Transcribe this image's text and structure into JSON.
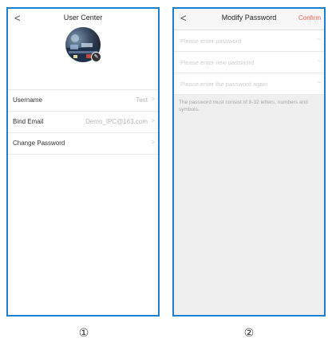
{
  "screen1": {
    "back_icon": "chevron-left-icon",
    "title": "User Center",
    "rows": [
      {
        "label": "Username",
        "value": "Test",
        "chevron": ">"
      },
      {
        "label": "Bind Email",
        "value": "Demo_IPC@163.com",
        "chevron": ">"
      },
      {
        "label": "Change Password",
        "value": "",
        "chevron": ">"
      }
    ],
    "caption": "①"
  },
  "screen2": {
    "back_icon": "chevron-left-icon",
    "title": "Modify Password",
    "confirm_label": "Confirm",
    "fields": [
      {
        "placeholder": "Please enter password",
        "eye": "~"
      },
      {
        "placeholder": "Please enter new password",
        "eye": "~"
      },
      {
        "placeholder": "Please enter the password again",
        "eye": "~"
      }
    ],
    "hint": "The password must consist of 8-32 letters, numbers and symbols.",
    "caption": "②"
  },
  "colors": {
    "frame": "#1a7fd0",
    "confirm": "#ff5a4f"
  }
}
